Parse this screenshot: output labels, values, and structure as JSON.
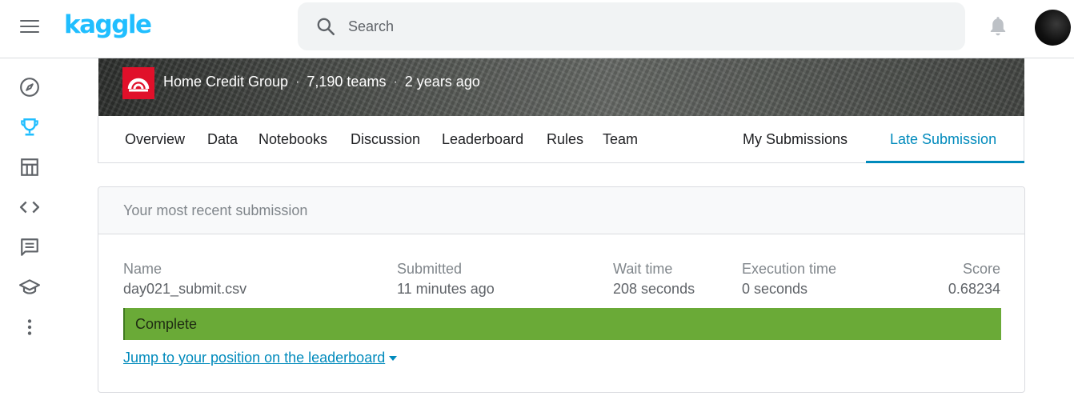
{
  "app": {
    "logo_text": "kaggle",
    "brand_color": "#20beff",
    "accent_color": "#008abc"
  },
  "search": {
    "placeholder": "Search"
  },
  "rail": {
    "icons": [
      "compass-icon",
      "trophy-icon",
      "table-icon",
      "code-icon",
      "comment-icon",
      "school-icon",
      "more-vert-icon"
    ],
    "active": "trophy-icon"
  },
  "competition": {
    "host": "Home Credit Group",
    "teams": "7,190 teams",
    "age": "2 years ago",
    "separator": "·"
  },
  "tabs": {
    "overview": "Overview",
    "data": "Data",
    "notebooks": "Notebooks",
    "discussion": "Discussion",
    "leaderboard": "Leaderboard",
    "rules": "Rules",
    "team": "Team",
    "my_submissions": "My Submissions",
    "late_submission": "Late Submission",
    "active": "Late Submission"
  },
  "submission": {
    "header": "Your most recent submission",
    "columns": {
      "name": {
        "label": "Name",
        "value": "day021_submit.csv"
      },
      "submitted": {
        "label": "Submitted",
        "value": "11 minutes ago"
      },
      "wait": {
        "label": "Wait time",
        "value": "208 seconds"
      },
      "execution": {
        "label": "Execution time",
        "value": "0 seconds"
      },
      "score": {
        "label": "Score",
        "value": "0.68234"
      }
    },
    "status": "Complete",
    "status_color": "#6aaa37",
    "jump_link": "Jump to your position on the leaderboard"
  }
}
